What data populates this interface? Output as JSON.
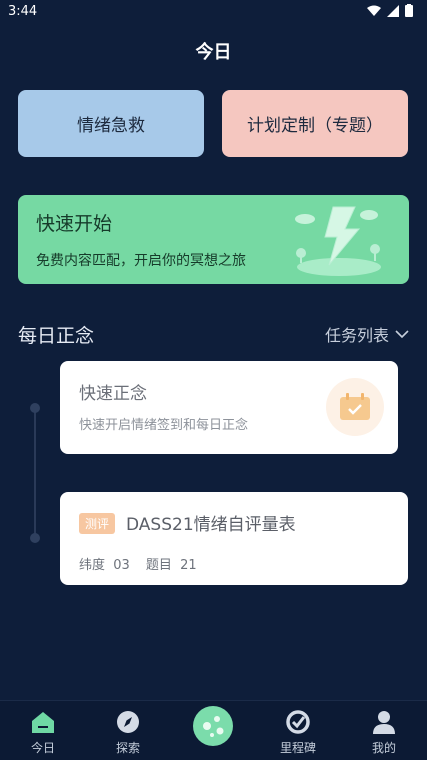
{
  "status": {
    "time": "3:44"
  },
  "page": {
    "title": "今日"
  },
  "top_buttons": {
    "rescue": "情绪急救",
    "plan": "计划定制（专题）"
  },
  "quick_start": {
    "title": "快速开始",
    "subtitle": "免费内容匹配，开启你的冥想之旅"
  },
  "section": {
    "title": "每日正念",
    "task_list": "任务列表"
  },
  "cards": [
    {
      "title": "快速正念",
      "subtitle": "快速开启情绪签到和每日正念"
    },
    {
      "badge": "测评",
      "title": "DASS21情绪自评量表",
      "dimension_label": "纬度",
      "dimension_value": "03",
      "question_label": "题目",
      "question_value": "21"
    }
  ],
  "tabs": [
    {
      "label": "今日",
      "icon": "home-icon"
    },
    {
      "label": "探索",
      "icon": "compass-icon"
    },
    {
      "label": "",
      "icon": "planet-icon"
    },
    {
      "label": "里程碑",
      "icon": "milestone-icon"
    },
    {
      "label": "我的",
      "icon": "user-icon"
    }
  ],
  "colors": {
    "background": "#0e1e3a",
    "accent_green": "#76d9a3",
    "rescue_blue": "#a7c9e9",
    "plan_pink": "#f5c7c0"
  }
}
